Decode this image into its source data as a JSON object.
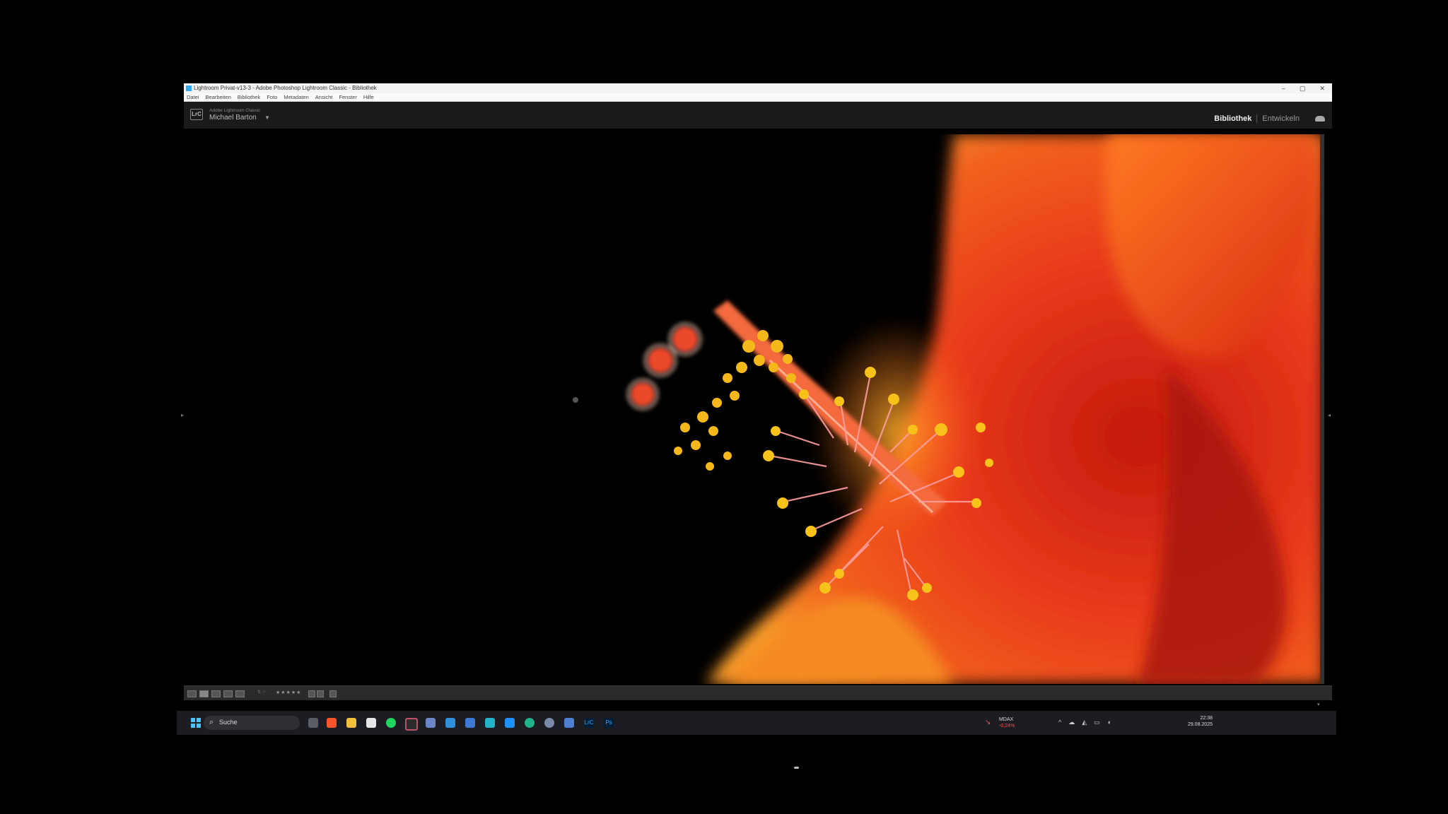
{
  "window": {
    "title": "Lightroom Privat-v13-3 - Adobe Photoshop Lightroom Classic - Bibliothek",
    "controls": [
      "–",
      "▢",
      "✕"
    ]
  },
  "menu": [
    "Datei",
    "Bearbeiten",
    "Bibliothek",
    "Foto",
    "Metadaten",
    "Ansicht",
    "Fenster",
    "Hilfe"
  ],
  "identity": {
    "product": "Adobe Lightroom Classic",
    "user": "Michael Barton",
    "caret": "▼",
    "logo": "LrC"
  },
  "modules": {
    "active": "Bibliothek",
    "inactive": "Entwickeln"
  },
  "toolbar": {
    "rating": "★★★★★",
    "sort_label": "⇅ ☆"
  },
  "taskbar": {
    "search_placeholder": "Suche",
    "icons": [
      "explorer-icon",
      "brave-icon",
      "folder-icon",
      "calendar-icon",
      "spotify-icon",
      "terminal-icon",
      "app-icon",
      "mail-icon",
      "remote-icon",
      "notes-icon",
      "tiktok-icon",
      "edge-icon",
      "settings-icon",
      "chat-icon",
      "lightroom-icon",
      "photoshop-icon"
    ],
    "lightroom_label": "LrC",
    "photoshop_label": "Ps"
  },
  "tray": {
    "ticker_symbol": "MDAX",
    "ticker_change": "-0,24%",
    "time": "22:38",
    "date": "29.08.2025"
  },
  "colors": {
    "accent": "#4cc2ff",
    "petal": "#e8391c",
    "stamen": "#f7c21a"
  }
}
